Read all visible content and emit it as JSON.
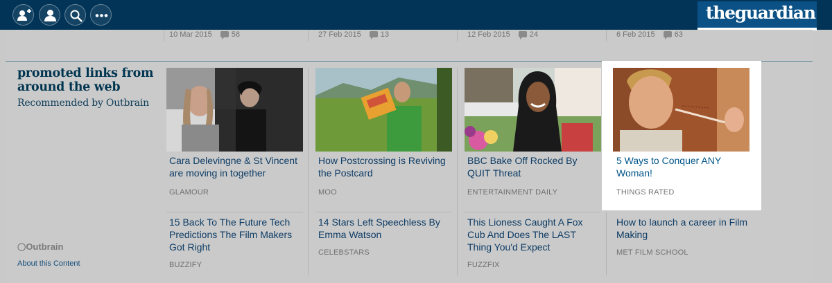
{
  "topbar": {
    "icons": [
      "add-user-icon",
      "user-icon",
      "search-icon",
      "more-icon"
    ],
    "logo_text": "theguardian"
  },
  "previous_row": [
    {
      "date": "10 Mar 2015",
      "comments": "58"
    },
    {
      "date": "27 Feb 2015",
      "comments": "13"
    },
    {
      "date": "12 Feb 2015",
      "comments": "24"
    },
    {
      "date": "6 Feb 2015",
      "comments": "63"
    }
  ],
  "promo": {
    "heading": "promoted links from around the web",
    "subheading": "Recommended by Outbrain",
    "brand": "Outbrain",
    "about_link": "About this Content"
  },
  "cards": [
    {
      "title": "Cara Delevingne & St Vincent are moving in together",
      "source": "GLAMOUR"
    },
    {
      "title": "How Postcrossing is Reviving the Postcard",
      "source": "MOO"
    },
    {
      "title": "BBC Bake Off Rocked By QUIT Threat",
      "source": "ENTERTAINMENT DAILY"
    },
    {
      "title": "5 Ways to Conquer ANY Woman!",
      "source": "THINGS RATED"
    },
    {
      "title": "15 Back To The Future Tech Predictions The Film Makers Got Right",
      "source": "BUZZIFY"
    },
    {
      "title": "14 Stars Left Speechless By Emma Watson",
      "source": "CELEBSTARS"
    },
    {
      "title": "This Lioness Caught A Fox Cub And Does The LAST Thing You'd Expect",
      "source": "FUZZFIX"
    },
    {
      "title": "How to launch a career in Film Making",
      "source": "MET FILM SCHOOL"
    }
  ],
  "colors": {
    "topbar": "#013457",
    "logo_bg": "#0b5185",
    "highlight": "#ffffff",
    "link": "#0d3c65"
  }
}
